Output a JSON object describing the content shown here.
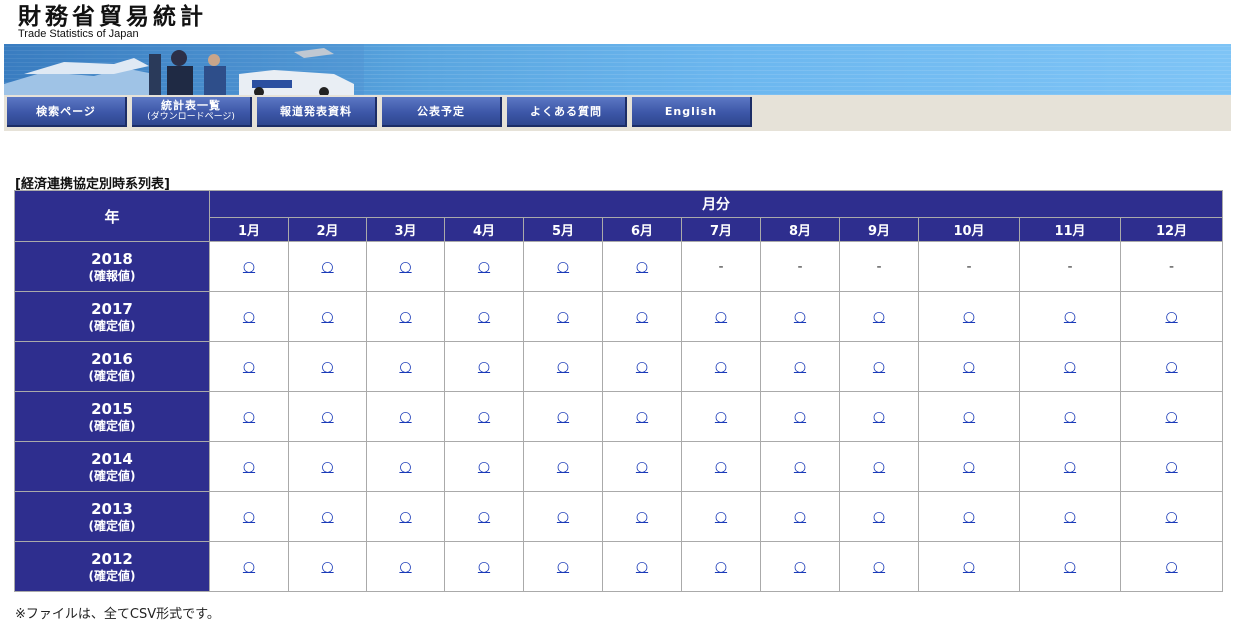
{
  "header": {
    "title": "財務省貿易統計",
    "subtitle": "Trade Statistics of Japan"
  },
  "nav": [
    {
      "label": "検索ページ"
    },
    {
      "label": "統計表一覧",
      "sub": "(ダウンロードページ)"
    },
    {
      "label": "報道発表資料"
    },
    {
      "label": "公表予定"
    },
    {
      "label": "よくある質問"
    },
    {
      "label": "English"
    }
  ],
  "section_title": "[経済連携協定別時系列表]",
  "table": {
    "year_header": "年",
    "month_group_header": "月分",
    "months": [
      "1月",
      "2月",
      "3月",
      "4月",
      "5月",
      "6月",
      "7月",
      "8月",
      "9月",
      "10月",
      "11月",
      "12月"
    ],
    "rows": [
      {
        "year": "2018",
        "status": "(確報値)",
        "cells": [
          "○",
          "○",
          "○",
          "○",
          "○",
          "○",
          "-",
          "-",
          "-",
          "-",
          "-",
          "-"
        ]
      },
      {
        "year": "2017",
        "status": "(確定値)",
        "cells": [
          "○",
          "○",
          "○",
          "○",
          "○",
          "○",
          "○",
          "○",
          "○",
          "○",
          "○",
          "○"
        ]
      },
      {
        "year": "2016",
        "status": "(確定値)",
        "cells": [
          "○",
          "○",
          "○",
          "○",
          "○",
          "○",
          "○",
          "○",
          "○",
          "○",
          "○",
          "○"
        ]
      },
      {
        "year": "2015",
        "status": "(確定値)",
        "cells": [
          "○",
          "○",
          "○",
          "○",
          "○",
          "○",
          "○",
          "○",
          "○",
          "○",
          "○",
          "○"
        ]
      },
      {
        "year": "2014",
        "status": "(確定値)",
        "cells": [
          "○",
          "○",
          "○",
          "○",
          "○",
          "○",
          "○",
          "○",
          "○",
          "○",
          "○",
          "○"
        ]
      },
      {
        "year": "2013",
        "status": "(確定値)",
        "cells": [
          "○",
          "○",
          "○",
          "○",
          "○",
          "○",
          "○",
          "○",
          "○",
          "○",
          "○",
          "○"
        ]
      },
      {
        "year": "2012",
        "status": "(確定値)",
        "cells": [
          "○",
          "○",
          "○",
          "○",
          "○",
          "○",
          "○",
          "○",
          "○",
          "○",
          "○",
          "○"
        ]
      }
    ]
  },
  "footnote": "※ファイルは、全てCSV形式です。",
  "colors": {
    "table_header": "#2e2e8e",
    "nav_button": "#3d57a8",
    "link": "#1a3ab8",
    "nav_bar_bg": "#e6e2d8"
  }
}
